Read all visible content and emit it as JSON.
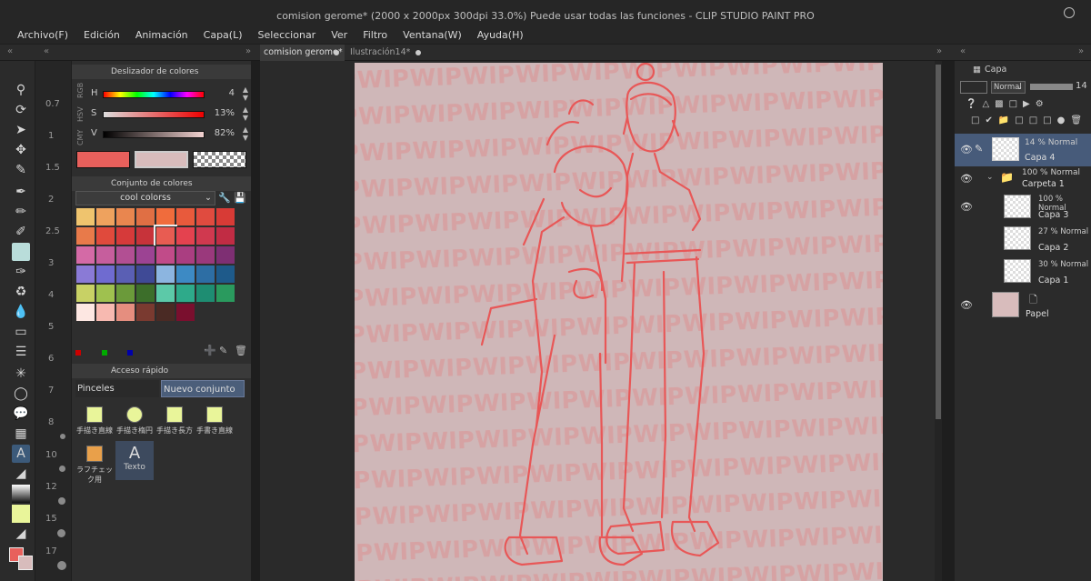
{
  "window": {
    "title": "comision gerome* (2000 x 2000px 300dpi 33.0%)  Puede usar todas las funciones - CLIP STUDIO PAINT PRO"
  },
  "menu": [
    "Archivo(F)",
    "Edición",
    "Animación",
    "Capa(L)",
    "Seleccionar",
    "Ver",
    "Filtro",
    "Ventana(W)",
    "Ayuda(H)"
  ],
  "tabs": [
    {
      "label": "comision gerome*"
    },
    {
      "label": "Ilustración14*"
    }
  ],
  "brush_sizes": [
    "0.7",
    "1",
    "1.5",
    "2",
    "2.5",
    "3",
    "4",
    "5",
    "6",
    "7",
    "8",
    "10",
    "12",
    "15",
    "17"
  ],
  "color_slider": {
    "title": "Deslizador de colores",
    "modes": [
      "RGB",
      "HSV",
      "CMY"
    ],
    "h": {
      "label": "H",
      "value": "4"
    },
    "s": {
      "label": "S",
      "value": "13%"
    },
    "v": {
      "label": "V",
      "value": "82%"
    }
  },
  "color_set": {
    "title": "Conjunto de colores",
    "selected": "cool colorss"
  },
  "palette": [
    "#efc46e",
    "#eea25e",
    "#e9864f",
    "#e06f44",
    "#f06c3c",
    "#e85a3c",
    "#e04b3f",
    "#d83b36",
    "#e87a4a",
    "#e04a3c",
    "#d63a3a",
    "#c7333a",
    "#e85c52",
    "#e4424f",
    "#d0394f",
    "#c12c44",
    "#d46aa6",
    "#c65e9d",
    "#b24f93",
    "#9c4393",
    "#c14b89",
    "#aa3e81",
    "#9a397c",
    "#7e2f73",
    "#8a7ad6",
    "#6f6bd0",
    "#5a5fb4",
    "#3f4a96",
    "#8cb5e0",
    "#3d8ac4",
    "#2d6ea4",
    "#1e5a8a",
    "#c8d165",
    "#9fc14f",
    "#6b9a3a",
    "#3c6e2a",
    "#5cc9a8",
    "#2eaa8a",
    "#1e8d72",
    "#2a9a5e",
    "#fde7e2",
    "#f7b9b0",
    "#e58e7f",
    "#7a3a30",
    "#4a2a24",
    "#7a0f2e"
  ],
  "quick_access": {
    "title": "Acceso rápido",
    "category": "Pinceles",
    "set": "Nuevo conjunto",
    "items": [
      "手描き直線",
      "手描き楕円",
      "手描き長方",
      "手書き直線",
      "ラフチェック用",
      "Texto"
    ]
  },
  "layers_panel": {
    "title": "Capa",
    "blend": "Normal",
    "opacity": "14",
    "layers": [
      {
        "pct": "14 % Normal",
        "name": "Capa 4"
      },
      {
        "pct": "100 % Normal",
        "name": "Carpeta 1"
      },
      {
        "pct": "100 % Normal",
        "name": "Capa 3"
      },
      {
        "pct": "27 % Normal",
        "name": "Capa 2"
      },
      {
        "pct": "30 % Normal",
        "name": "Capa 1"
      },
      {
        "pct": "",
        "name": "Papel"
      }
    ]
  },
  "watermark": "WIP",
  "colors": {
    "main": "#e8605c",
    "sub": "#d8bcbc"
  }
}
